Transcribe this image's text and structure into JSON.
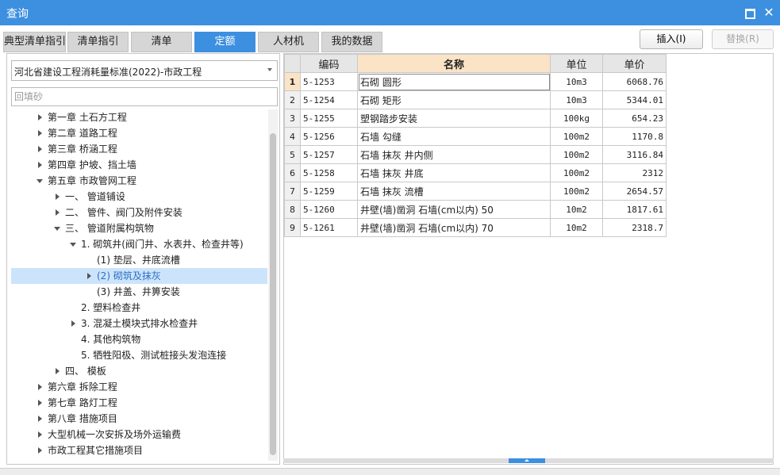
{
  "window": {
    "title": "查询"
  },
  "tabs": [
    {
      "label": "典型清单指引",
      "active": false
    },
    {
      "label": "清单指引",
      "active": false
    },
    {
      "label": "清单",
      "active": false
    },
    {
      "label": "定额",
      "active": true
    },
    {
      "label": "人材机",
      "active": false
    },
    {
      "label": "我的数据",
      "active": false
    }
  ],
  "toolbar": {
    "insert_label": "插入(I)",
    "replace_label": "替换(R)"
  },
  "left": {
    "standard_selected": "河北省建设工程消耗量标准(2022)-市政工程",
    "search_placeholder": "回填砂",
    "tree": [
      {
        "label": "第一章 土石方工程",
        "toggle": "closed",
        "level": 0
      },
      {
        "label": "第二章 道路工程",
        "toggle": "closed",
        "level": 0
      },
      {
        "label": "第三章 桥涵工程",
        "toggle": "closed",
        "level": 0
      },
      {
        "label": "第四章 护坡、挡土墙",
        "toggle": "closed",
        "level": 0
      },
      {
        "label": "第五章 市政管网工程",
        "toggle": "open",
        "level": 0
      },
      {
        "label": "一、 管道铺设",
        "toggle": "closed",
        "level": 1
      },
      {
        "label": "二、 管件、阀门及附件安装",
        "toggle": "closed",
        "level": 1
      },
      {
        "label": "三、 管道附属构筑物",
        "toggle": "open",
        "level": 1
      },
      {
        "label": "1. 砌筑井(阀门井、水表井、检查井等)",
        "toggle": "open",
        "level": 2
      },
      {
        "label": "(1) 垫层、井底流槽",
        "toggle": "none",
        "level": 3
      },
      {
        "label": "(2) 砌筑及抹灰",
        "toggle": "closed",
        "level": 3,
        "selected": true
      },
      {
        "label": "(3) 井盖、井箅安装",
        "toggle": "none",
        "level": 3
      },
      {
        "label": "2. 塑料检查井",
        "toggle": "none",
        "level": 2
      },
      {
        "label": "3. 混凝土模块式排水检查井",
        "toggle": "closed",
        "level": 2
      },
      {
        "label": "4. 其他构筑物",
        "toggle": "none",
        "level": 2
      },
      {
        "label": "5. 牺牲阳极、测试桩接头发泡连接",
        "toggle": "none",
        "level": 2
      },
      {
        "label": "四、 模板",
        "toggle": "closed",
        "level": 1
      },
      {
        "label": "第六章 拆除工程",
        "toggle": "closed",
        "level": 0
      },
      {
        "label": "第七章 路灯工程",
        "toggle": "closed",
        "level": 0
      },
      {
        "label": "第八章 措施项目",
        "toggle": "closed",
        "level": 0
      },
      {
        "label": "大型机械一次安拆及场外运输费",
        "toggle": "closed",
        "level": 0
      },
      {
        "label": "市政工程其它措施项目",
        "toggle": "closed",
        "level": 0
      }
    ]
  },
  "grid": {
    "headers": {
      "code": "编码",
      "name": "名称",
      "unit": "单位",
      "price": "单价"
    },
    "rows": [
      {
        "n": "1",
        "code": "5-1253",
        "name": "石砌 圆形",
        "unit": "10m3",
        "price": "6068.76",
        "active": true
      },
      {
        "n": "2",
        "code": "5-1254",
        "name": "石砌 矩形",
        "unit": "10m3",
        "price": "5344.01"
      },
      {
        "n": "3",
        "code": "5-1255",
        "name": "塑钢踏步安装",
        "unit": "100kg",
        "price": "654.23"
      },
      {
        "n": "4",
        "code": "5-1256",
        "name": "石墙 勾缝",
        "unit": "100m2",
        "price": "1170.8"
      },
      {
        "n": "5",
        "code": "5-1257",
        "name": "石墙 抹灰 井内侧",
        "unit": "100m2",
        "price": "3116.84"
      },
      {
        "n": "6",
        "code": "5-1258",
        "name": "石墙 抹灰 井底",
        "unit": "100m2",
        "price": "2312"
      },
      {
        "n": "7",
        "code": "5-1259",
        "name": "石墙 抹灰 流槽",
        "unit": "100m2",
        "price": "2654.57"
      },
      {
        "n": "8",
        "code": "5-1260",
        "name": "井壁(墙)凿洞 石墙(cm以内) 50",
        "unit": "10m2",
        "price": "1817.61"
      },
      {
        "n": "9",
        "code": "5-1261",
        "name": "井壁(墙)凿洞 石墙(cm以内) 70",
        "unit": "10m2",
        "price": "2318.7"
      }
    ]
  }
}
